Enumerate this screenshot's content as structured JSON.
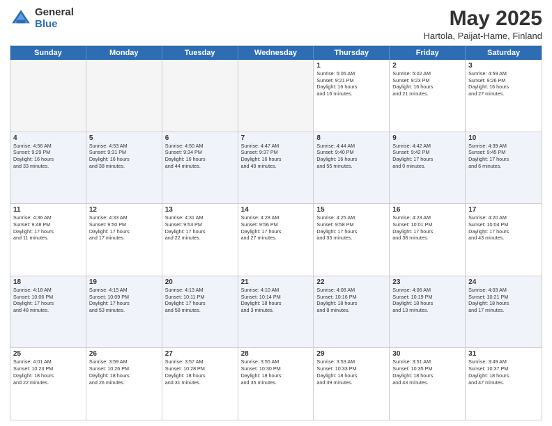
{
  "logo": {
    "general": "General",
    "blue": "Blue"
  },
  "header": {
    "title": "May 2025",
    "subtitle": "Hartola, Paijat-Hame, Finland"
  },
  "days_of_week": [
    "Sunday",
    "Monday",
    "Tuesday",
    "Wednesday",
    "Thursday",
    "Friday",
    "Saturday"
  ],
  "rows": [
    {
      "alt": false,
      "cells": [
        {
          "day": "",
          "info": "",
          "empty": true
        },
        {
          "day": "",
          "info": "",
          "empty": true
        },
        {
          "day": "",
          "info": "",
          "empty": true
        },
        {
          "day": "",
          "info": "",
          "empty": true
        },
        {
          "day": "1",
          "info": "Sunrise: 5:05 AM\nSunset: 9:21 PM\nDaylight: 16 hours\nand 16 minutes."
        },
        {
          "day": "2",
          "info": "Sunrise: 5:02 AM\nSunset: 9:23 PM\nDaylight: 16 hours\nand 21 minutes."
        },
        {
          "day": "3",
          "info": "Sunrise: 4:59 AM\nSunset: 9:26 PM\nDaylight: 16 hours\nand 27 minutes."
        }
      ]
    },
    {
      "alt": true,
      "cells": [
        {
          "day": "4",
          "info": "Sunrise: 4:56 AM\nSunset: 9:29 PM\nDaylight: 16 hours\nand 33 minutes."
        },
        {
          "day": "5",
          "info": "Sunrise: 4:53 AM\nSunset: 9:31 PM\nDaylight: 16 hours\nand 38 minutes."
        },
        {
          "day": "6",
          "info": "Sunrise: 4:50 AM\nSunset: 9:34 PM\nDaylight: 16 hours\nand 44 minutes."
        },
        {
          "day": "7",
          "info": "Sunrise: 4:47 AM\nSunset: 9:37 PM\nDaylight: 16 hours\nand 49 minutes."
        },
        {
          "day": "8",
          "info": "Sunrise: 4:44 AM\nSunset: 9:40 PM\nDaylight: 16 hours\nand 55 minutes."
        },
        {
          "day": "9",
          "info": "Sunrise: 4:42 AM\nSunset: 9:42 PM\nDaylight: 17 hours\nand 0 minutes."
        },
        {
          "day": "10",
          "info": "Sunrise: 4:39 AM\nSunset: 9:45 PM\nDaylight: 17 hours\nand 6 minutes."
        }
      ]
    },
    {
      "alt": false,
      "cells": [
        {
          "day": "11",
          "info": "Sunrise: 4:36 AM\nSunset: 9:48 PM\nDaylight: 17 hours\nand 11 minutes."
        },
        {
          "day": "12",
          "info": "Sunrise: 4:33 AM\nSunset: 9:50 PM\nDaylight: 17 hours\nand 17 minutes."
        },
        {
          "day": "13",
          "info": "Sunrise: 4:31 AM\nSunset: 9:53 PM\nDaylight: 17 hours\nand 22 minutes."
        },
        {
          "day": "14",
          "info": "Sunrise: 4:28 AM\nSunset: 9:56 PM\nDaylight: 17 hours\nand 27 minutes."
        },
        {
          "day": "15",
          "info": "Sunrise: 4:25 AM\nSunset: 9:58 PM\nDaylight: 17 hours\nand 33 minutes."
        },
        {
          "day": "16",
          "info": "Sunrise: 4:23 AM\nSunset: 10:01 PM\nDaylight: 17 hours\nand 38 minutes."
        },
        {
          "day": "17",
          "info": "Sunrise: 4:20 AM\nSunset: 10:04 PM\nDaylight: 17 hours\nand 43 minutes."
        }
      ]
    },
    {
      "alt": true,
      "cells": [
        {
          "day": "18",
          "info": "Sunrise: 4:18 AM\nSunset: 10:06 PM\nDaylight: 17 hours\nand 48 minutes."
        },
        {
          "day": "19",
          "info": "Sunrise: 4:15 AM\nSunset: 10:09 PM\nDaylight: 17 hours\nand 53 minutes."
        },
        {
          "day": "20",
          "info": "Sunrise: 4:13 AM\nSunset: 10:11 PM\nDaylight: 17 hours\nand 58 minutes."
        },
        {
          "day": "21",
          "info": "Sunrise: 4:10 AM\nSunset: 10:14 PM\nDaylight: 18 hours\nand 3 minutes."
        },
        {
          "day": "22",
          "info": "Sunrise: 4:08 AM\nSunset: 10:16 PM\nDaylight: 18 hours\nand 8 minutes."
        },
        {
          "day": "23",
          "info": "Sunrise: 4:06 AM\nSunset: 10:19 PM\nDaylight: 18 hours\nand 13 minutes."
        },
        {
          "day": "24",
          "info": "Sunrise: 4:03 AM\nSunset: 10:21 PM\nDaylight: 18 hours\nand 17 minutes."
        }
      ]
    },
    {
      "alt": false,
      "cells": [
        {
          "day": "25",
          "info": "Sunrise: 4:01 AM\nSunset: 10:23 PM\nDaylight: 18 hours\nand 22 minutes."
        },
        {
          "day": "26",
          "info": "Sunrise: 3:59 AM\nSunset: 10:26 PM\nDaylight: 18 hours\nand 26 minutes."
        },
        {
          "day": "27",
          "info": "Sunrise: 3:57 AM\nSunset: 10:28 PM\nDaylight: 18 hours\nand 31 minutes."
        },
        {
          "day": "28",
          "info": "Sunrise: 3:55 AM\nSunset: 10:30 PM\nDaylight: 18 hours\nand 35 minutes."
        },
        {
          "day": "29",
          "info": "Sunrise: 3:53 AM\nSunset: 10:33 PM\nDaylight: 18 hours\nand 39 minutes."
        },
        {
          "day": "30",
          "info": "Sunrise: 3:51 AM\nSunset: 10:35 PM\nDaylight: 18 hours\nand 43 minutes."
        },
        {
          "day": "31",
          "info": "Sunrise: 3:49 AM\nSunset: 10:37 PM\nDaylight: 18 hours\nand 47 minutes."
        }
      ]
    }
  ]
}
